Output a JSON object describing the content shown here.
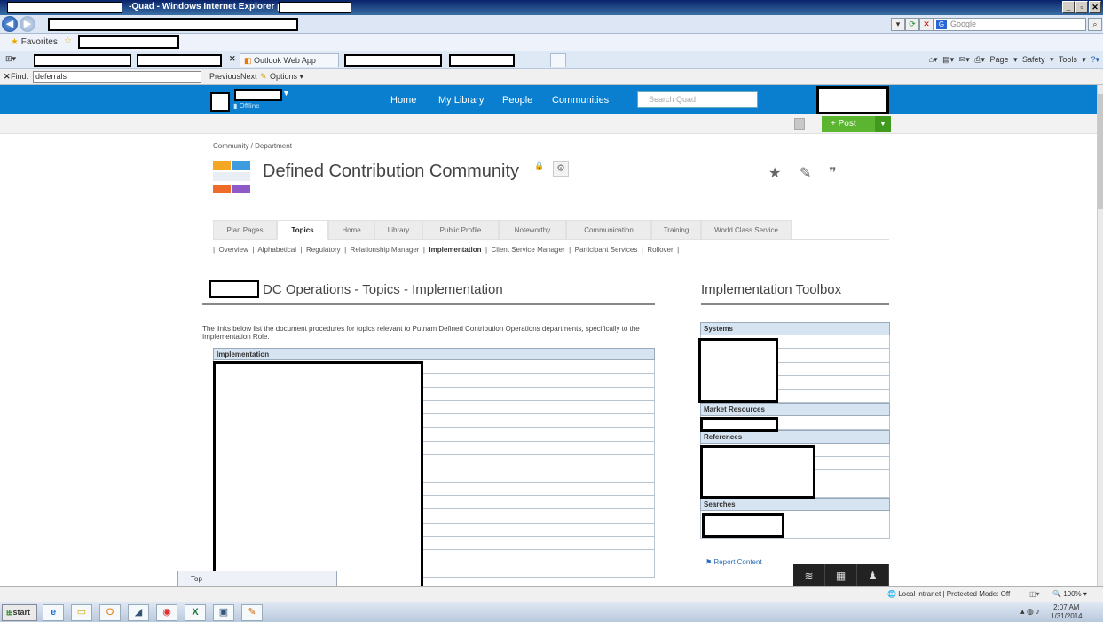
{
  "window": {
    "title": "-Quad - Windows Internet Explorer provided by"
  },
  "address_bar": {
    "search_engine": "Google",
    "search_icon": "search-icon"
  },
  "favorites_bar": {
    "label": "Favorites"
  },
  "browser_tabs": [
    {
      "label": "Outlook Web App"
    }
  ],
  "browser_tools": {
    "page": "Page ▾",
    "safety": "Safety ▾",
    "tools": "Tools ▾"
  },
  "find_bar": {
    "label": "Find:",
    "value": "deferrals",
    "previous": "Previous",
    "next": "Next",
    "options": "Options ▾"
  },
  "site_nav": {
    "offline_label": "Offline",
    "links": [
      "Home",
      "My Library",
      "People",
      "Communities"
    ],
    "search_placeholder": "Search Quad",
    "post_label": "+ Post"
  },
  "community": {
    "breadcrumb": "Community / Department",
    "title": "Defined Contribution Community"
  },
  "page_tabs": [
    {
      "label": "Plan Pages",
      "active": false
    },
    {
      "label": "Topics",
      "active": true
    },
    {
      "label": "Home",
      "active": false
    },
    {
      "label": "Library",
      "active": false
    },
    {
      "label": "Public Profile",
      "active": false
    },
    {
      "label": "Noteworthy",
      "active": false
    },
    {
      "label": "Communication",
      "active": false
    },
    {
      "label": "Training",
      "active": false
    },
    {
      "label": "World Class Service",
      "active": false
    }
  ],
  "sub_nav": [
    "Overview",
    "Alphabetical",
    "Regulatory",
    "Relationship Manager",
    "Implementation",
    "Client Service Manager",
    "Participant Services",
    "Rollover"
  ],
  "sub_nav_active": "Implementation",
  "main": {
    "title": "DC Operations - Topics - Implementation",
    "intro": "The links below list the document procedures for topics relevant to Putnam Defined Contribution Operations departments, specifically to the Implementation Role.",
    "table_header": "Implementation"
  },
  "toolbox": {
    "title": "Implementation Toolbox",
    "sections": [
      "Systems",
      "Market Resources",
      "References",
      "Searches"
    ],
    "report_link": "Report Content"
  },
  "status_bar": {
    "zone": "Local intranet | Protected Mode: Off",
    "zoom": "100%"
  },
  "taskbar": {
    "start": "start",
    "time": "2:07 AM",
    "date": "1/31/2014",
    "tab_preview": "Top"
  }
}
